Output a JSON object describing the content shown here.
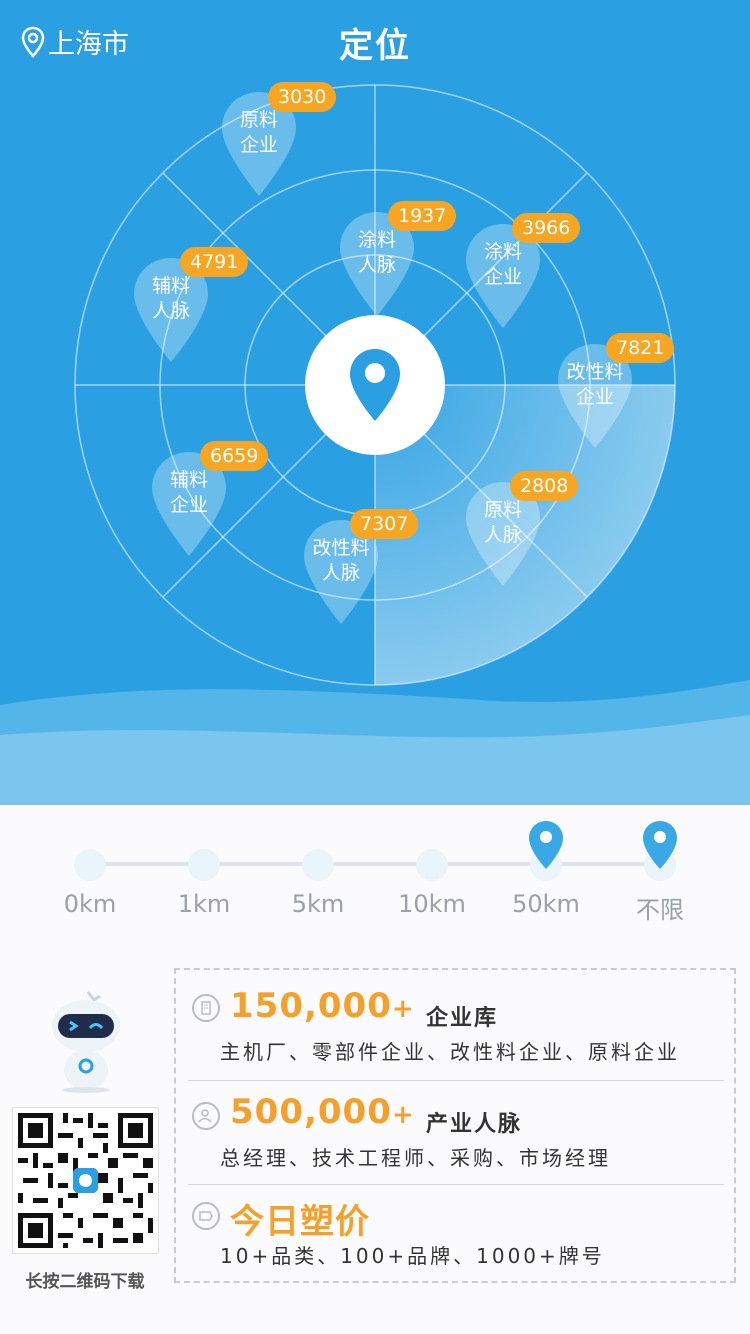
{
  "header": {
    "location_label": "上海市",
    "title": "定位"
  },
  "radar": {
    "center_icon": "location-pin-icon",
    "pins": [
      {
        "id": "pin-raw-enterprise-outer",
        "line1": "原料",
        "line2": "企业",
        "count": "3030"
      },
      {
        "id": "pin-coating-people",
        "line1": "涂料",
        "line2": "人脉",
        "count": "1937"
      },
      {
        "id": "pin-coating-enterprise",
        "line1": "涂料",
        "line2": "企业",
        "count": "3966"
      },
      {
        "id": "pin-auxiliary-people",
        "line1": "辅料",
        "line2": "人脉",
        "count": "4791"
      },
      {
        "id": "pin-modified-enterprise",
        "line1": "改性料",
        "line2": "企业",
        "count": "7821"
      },
      {
        "id": "pin-auxiliary-enterprise",
        "line1": "辅料",
        "line2": "企业",
        "count": "6659"
      },
      {
        "id": "pin-raw-people",
        "line1": "原料",
        "line2": "人脉",
        "count": "2808"
      },
      {
        "id": "pin-modified-people",
        "line1": "改性料",
        "line2": "人脉",
        "count": "7307"
      }
    ]
  },
  "distance": {
    "options": [
      "0km",
      "1km",
      "5km",
      "10km",
      "50km",
      "不限"
    ],
    "selected": [
      "50km",
      "不限"
    ]
  },
  "promo": {
    "qr_caption": "长按二维码下载",
    "rows": [
      {
        "number": "150,000",
        "plus": "+",
        "tag": "企业库",
        "desc": "主机厂、零部件企业、改性料企业、原料企业",
        "icon": "building-icon"
      },
      {
        "number": "500,000",
        "plus": "+",
        "tag": "产业人脉",
        "desc": "总经理、技术工程师、采购、市场经理",
        "icon": "people-icon"
      },
      {
        "number": "今日塑价",
        "plus": "",
        "tag": "",
        "desc": "10+品类、100+品牌、1000+牌号",
        "icon": "price-tag-icon"
      }
    ]
  },
  "colors": {
    "primary_blue": "#2aa0e2",
    "accent_orange": "#f6a623",
    "marker_blue": "#3aa8e4"
  }
}
